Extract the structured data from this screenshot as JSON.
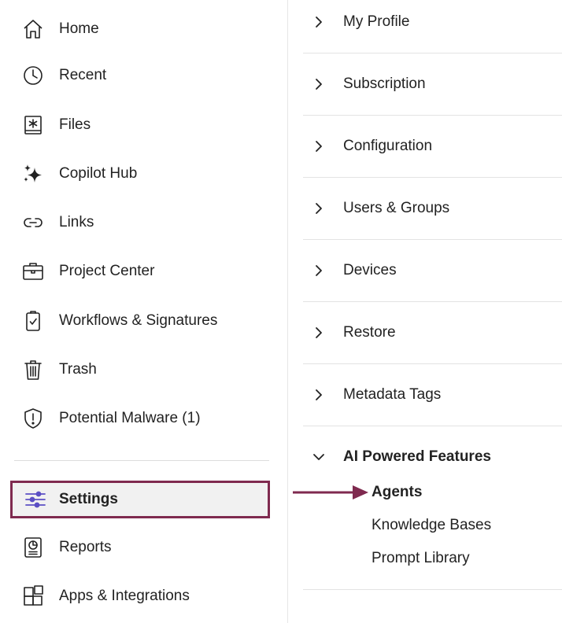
{
  "sidebar": {
    "items": [
      {
        "label": "Home",
        "icon": "home-icon"
      },
      {
        "label": "Recent",
        "icon": "clock-icon"
      },
      {
        "label": "Files",
        "icon": "files-icon"
      },
      {
        "label": "Copilot Hub",
        "icon": "sparkle-icon"
      },
      {
        "label": "Links",
        "icon": "link-icon"
      },
      {
        "label": "Project Center",
        "icon": "briefcase-icon"
      },
      {
        "label": "Workflows & Signatures",
        "icon": "clipboard-check-icon"
      },
      {
        "label": "Trash",
        "icon": "trash-icon"
      },
      {
        "label": "Potential Malware (1)",
        "icon": "shield-alert-icon"
      },
      {
        "label": "Settings",
        "icon": "sliders-icon",
        "active": true
      },
      {
        "label": "Reports",
        "icon": "report-icon"
      },
      {
        "label": "Apps & Integrations",
        "icon": "apps-icon"
      }
    ]
  },
  "settings": {
    "sections": [
      {
        "label": "My Profile"
      },
      {
        "label": "Subscription"
      },
      {
        "label": "Configuration"
      },
      {
        "label": "Users & Groups"
      },
      {
        "label": "Devices"
      },
      {
        "label": "Restore"
      },
      {
        "label": "Metadata Tags"
      }
    ],
    "expanded": {
      "label": "AI Powered Features",
      "items": [
        {
          "label": "Agents",
          "active": true
        },
        {
          "label": "Knowledge Bases"
        },
        {
          "label": "Prompt Library"
        }
      ]
    }
  },
  "colors": {
    "accent": "#7f2a4f",
    "settings_icon": "#5b4fc4",
    "text": "#222222",
    "divider": "#e3e3e3"
  }
}
